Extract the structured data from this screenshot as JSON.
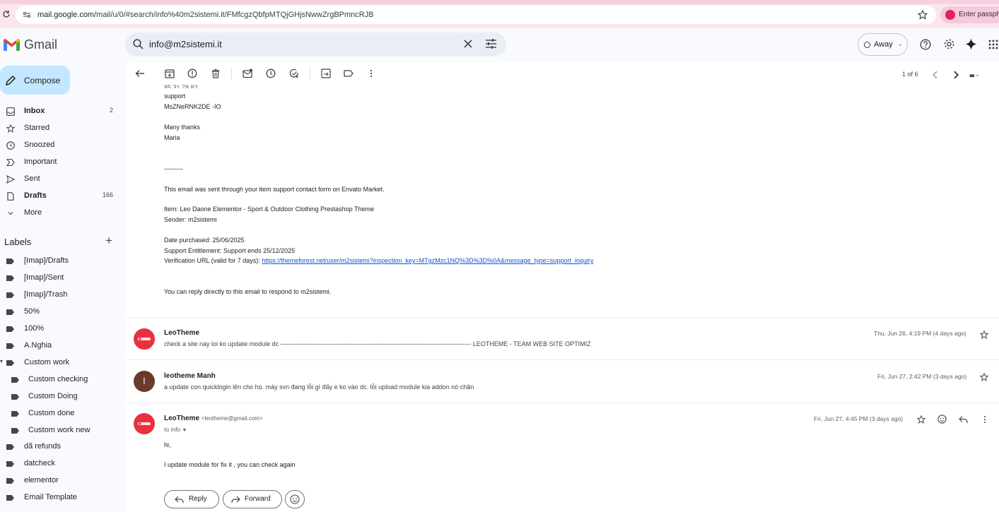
{
  "browser": {
    "url_host": "mail.google.com",
    "url_path": "/mail/u/0/#search/info%40m2sistemi.it/FMfcgzQbfpMTQjGHjsNwwZrgBPmncRJB",
    "passphrase_label": "Enter passphra"
  },
  "header": {
    "app_name": "Gmail",
    "search_value": "info@m2sistemi.it",
    "status_label": "Away"
  },
  "sidebar": {
    "compose_label": "Compose",
    "items": [
      {
        "label": "Inbox",
        "count": "2"
      },
      {
        "label": "Starred",
        "count": ""
      },
      {
        "label": "Snoozed",
        "count": ""
      },
      {
        "label": "Important",
        "count": ""
      },
      {
        "label": "Sent",
        "count": ""
      },
      {
        "label": "Drafts",
        "count": "166"
      },
      {
        "label": "More",
        "count": ""
      }
    ],
    "labels_title": "Labels",
    "labels": [
      "[Imap]/Drafts",
      "[Imap]/Sent",
      "[Imap]/Trash",
      "50%",
      "100%",
      "A.Nghia",
      "Custom work",
      "Custom checking",
      "Custom Doing",
      "Custom done",
      "Custom work new",
      "dã refunds",
      "datcheck",
      "elementor",
      "Email Template"
    ]
  },
  "toolbar": {
    "page_count": "1 of 6"
  },
  "message_body": {
    "line_support": "support",
    "line_code": "MsZNeRNK2DE -IO",
    "thanks": "Many thanks",
    "name": "Maria",
    "divider": "---------",
    "sent_through": "This email was sent through your item support contact form on Envato Market.",
    "item": "Item: Leo Daone Elementor - Sport & Outdoor Clothing Prestashop Theme",
    "sender": "Sender: m2sistemi",
    "date_purchased": "Date purchased: 25/06/2025",
    "entitlement": "Support Entitlement: Support ends 25/12/2025",
    "verification_prefix": "Verification URL (valid for 7 days): ",
    "verification_url": "https://themeforest.net/user/m2sistemi?inspection_key=MTgzMzc1NQ%3D%3D%0A&message_type=support_inquiry",
    "reply_note": "You can reply directly to this email to respond to m2sistemi."
  },
  "thread": [
    {
      "sender": "LeoTheme",
      "snippet": "check a site nay loi ko update module dc ------------------------------------------------------------------------------------------ LEOTHEME - TEAM WEB SITE OPTIMIZ",
      "date": "Thu, Jun 26, 4:19 PM (4 days ago)"
    },
    {
      "sender": "leotheme Manh",
      "avatar_letter": "l",
      "snippet": "a update con quicklogin lên cho họ. máy svn đang lỗi gì đấy e ko vào dc. lỗi upload module kia addon nó chặn",
      "date": "Fri, Jun 27, 2:42 PM (3 days ago)"
    },
    {
      "sender": "LeoTheme",
      "address": "<leotheme@gmail.com>",
      "to": "to info",
      "date": "Fri, Jun 27, 4:45 PM (3 days ago)",
      "greeting": "hi,",
      "body": "I update module for fix it , you can check again"
    }
  ],
  "actions": {
    "reply_label": "Reply",
    "forward_label": "Forward"
  },
  "colors": {
    "compose_bg": "#c2e7ff",
    "search_bg": "#e9eef6",
    "link": "#1155cc",
    "leotheme_red": "#e8303f",
    "manh_brown": "#6b3a2a"
  }
}
